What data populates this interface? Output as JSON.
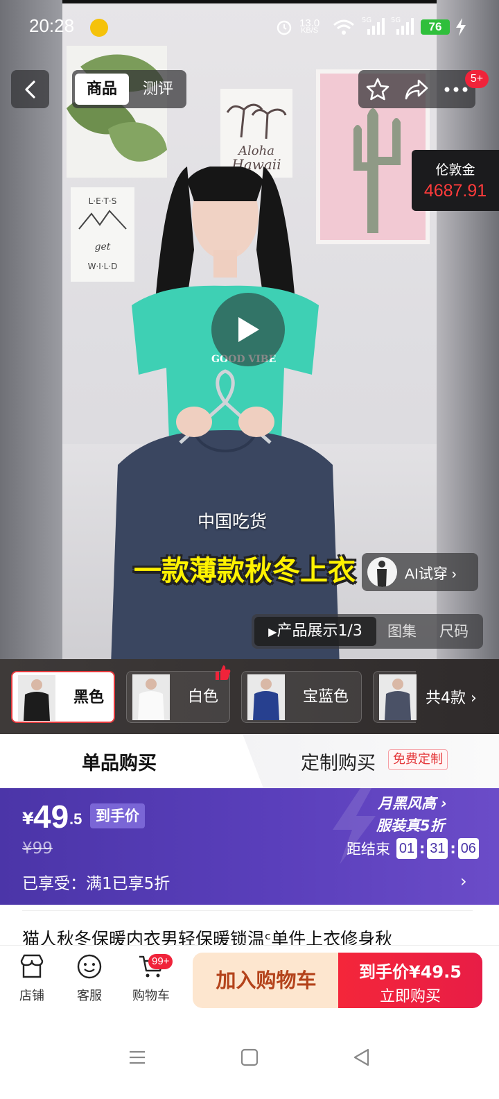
{
  "status_bar": {
    "time": "20:28",
    "net_speed_value": "13.0",
    "net_speed_unit": "KB/S",
    "battery": "76",
    "icons": [
      "app-badge-icon",
      "alarm-icon",
      "wifi-icon",
      "signal-5g-icon",
      "signal-5g-icon",
      "charging-icon"
    ]
  },
  "top_bar": {
    "tabs": [
      {
        "label": "商品",
        "active": true
      },
      {
        "label": "测评",
        "active": false
      }
    ],
    "notification_badge": "5+",
    "icons": [
      "back-icon",
      "star-icon",
      "share-icon",
      "more-icon"
    ]
  },
  "gold_ticker": {
    "label": "伦敦金",
    "value": "4687.91"
  },
  "video": {
    "caption_small": "中国吃货",
    "caption_big": "一款薄款秋冬上衣",
    "ai_try_label": "AI试穿 ›",
    "media_tabs": {
      "active": "产品展示1/3",
      "gallery": "图集",
      "size": "尺码"
    }
  },
  "variants": {
    "items": [
      {
        "label": "黑色",
        "selected": true
      },
      {
        "label": "白色",
        "selected": false
      },
      {
        "label": "宝蓝色",
        "selected": false
      }
    ],
    "more_label": "共4款 ›"
  },
  "buy_mode": {
    "single": "单品购买",
    "custom": "定制购买",
    "custom_tag": "免费定制"
  },
  "price": {
    "yen": "¥",
    "integer": "49",
    "decimal": ".5",
    "tag": "到手价",
    "original": "¥99",
    "promo": "已享受：满1已享5折",
    "brand_line1": "月黑风高 ›",
    "brand_line2": "服装真5折",
    "countdown_label": "距结束",
    "countdown": [
      "01",
      "31",
      "06"
    ],
    "accent_color": "#4b35a8"
  },
  "product": {
    "title": "猫人秋冬保暖内衣男轻保暖锁温ᶜ单件上衣修身秋"
  },
  "bottom_bar": {
    "store": "店铺",
    "service": "客服",
    "cart": "购物车",
    "cart_badge": "99+",
    "add_to_cart": "加入购物车",
    "buy_now_price": "到手价¥49.5",
    "buy_now": "立即购买",
    "buy_color": "#f4263a"
  },
  "system_nav": {
    "icons": [
      "menu-icon",
      "home-icon",
      "back-triangle-icon"
    ]
  }
}
